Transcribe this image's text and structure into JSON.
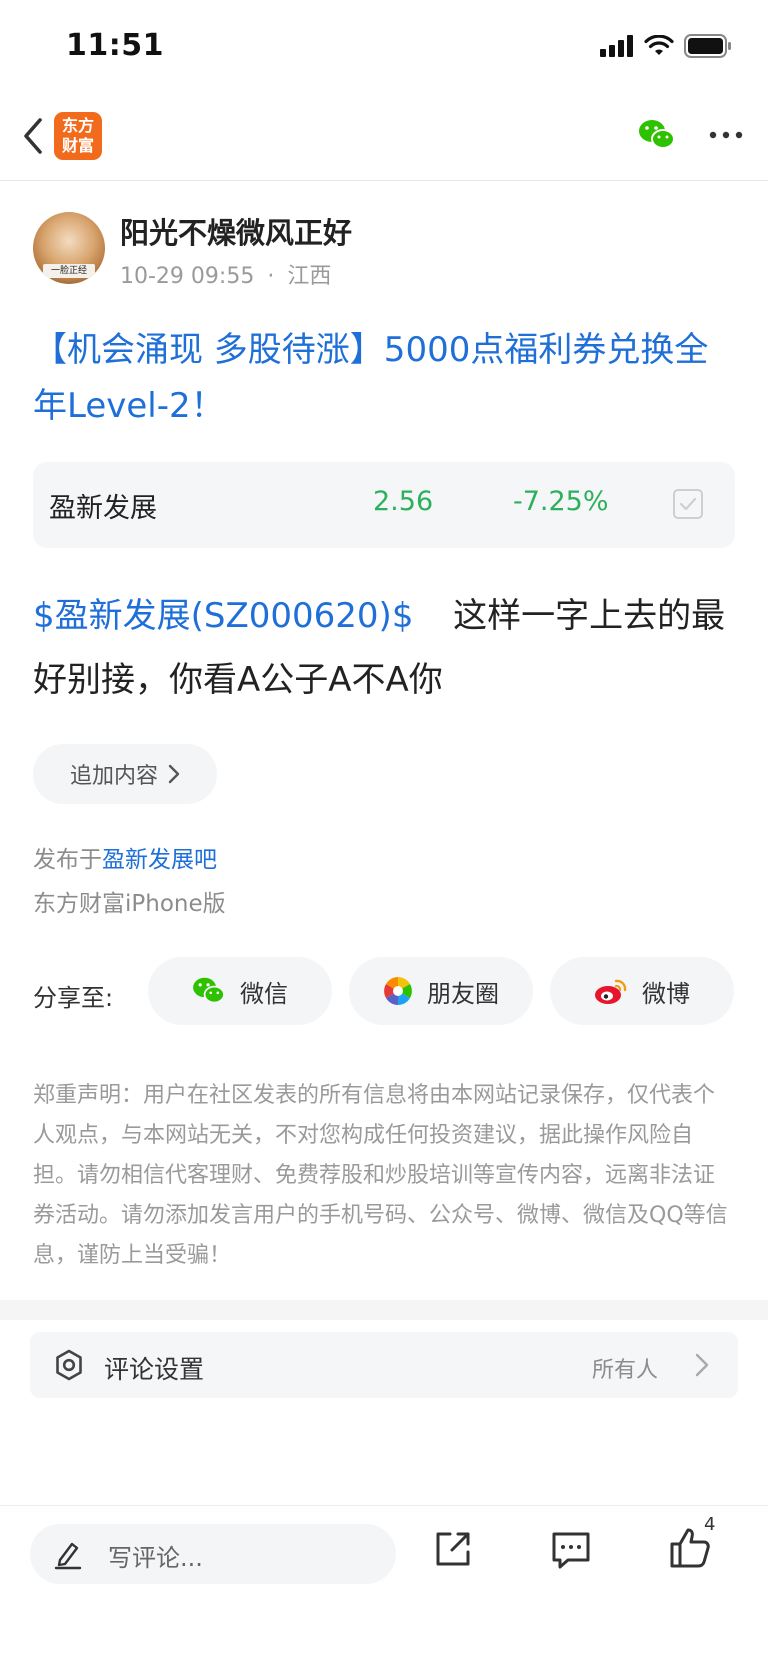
{
  "status_bar": {
    "time": "11:51"
  },
  "nav": {
    "logo_line1": "东方",
    "logo_line2": "财富"
  },
  "author": {
    "name": "阳光不燥微风正好",
    "time": "10-29 09:55",
    "separator": "·",
    "location": "江西",
    "avatar_caption": "一脸正经"
  },
  "post": {
    "title": "【机会涌现 多股待涨】5000点福利券兑换全年Level-2！",
    "stock_card": {
      "name": "盈新发展",
      "price": "2.56",
      "change": "-7.25%"
    },
    "body_link": "$盈新发展(SZ000620)$",
    "body_text": "这样一字上去的最好别接，你看A公子A不A你",
    "add_content_label": "追加内容",
    "published_prefix": "发布于",
    "published_bar": "盈新发展吧",
    "client": "东方财富iPhone版"
  },
  "share": {
    "label": "分享至:",
    "buttons": [
      {
        "label": "微信",
        "icon": "wechat-icon"
      },
      {
        "label": "朋友圈",
        "icon": "moments-icon"
      },
      {
        "label": "微博",
        "icon": "weibo-icon"
      }
    ]
  },
  "disclaimer": "郑重声明：用户在社区发表的所有信息将由本网站记录保存，仅代表个人观点，与本网站无关，不对您构成任何投资建议，据此操作风险自担。请勿相信代客理财、免费荐股和炒股培训等宣传内容，远离非法证券活动。请勿添加发言用户的手机号码、公众号、微博、微信及QQ等信息，谨防上当受骗！",
  "comment_settings": {
    "label": "评论设置",
    "value": "所有人"
  },
  "bottom_bar": {
    "comment_placeholder": "写评论...",
    "like_count": "4"
  },
  "colors": {
    "brand": "#f26b1d",
    "link": "#1f6fd8",
    "down": "#2db05c",
    "wechat": "#2dc100"
  }
}
